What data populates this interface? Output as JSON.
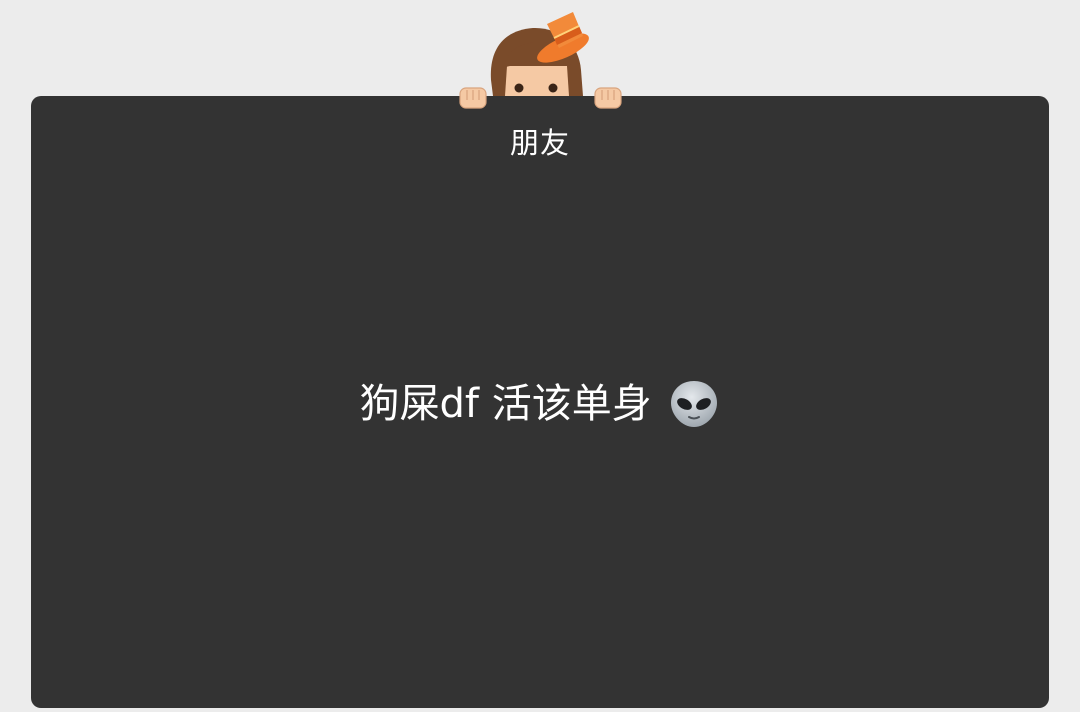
{
  "card": {
    "title": "朋友",
    "message": "狗屎df 活该单身",
    "message_emoji": "alien-face-icon",
    "background_color": "#333333"
  },
  "page": {
    "background_color": "#ececec"
  },
  "mascot": {
    "icon": "peeking-girl-with-orange-hat-icon"
  }
}
